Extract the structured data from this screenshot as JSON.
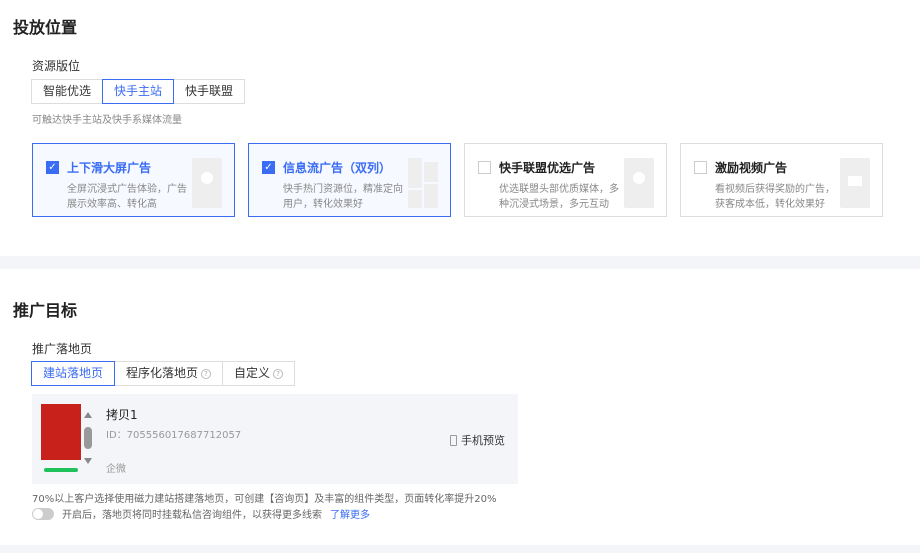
{
  "placement": {
    "title": "投放位置",
    "resource_label": "资源版位",
    "options": [
      "智能优选",
      "快手主站",
      "快手联盟"
    ],
    "selected": "快手主站",
    "hint": "可触达快手主站及快手系媒体流量",
    "cards": [
      {
        "title": "上下滑大屏广告",
        "desc": "全屏沉浸式广告体验，广告展示效率高、转化高",
        "checked": true
      },
      {
        "title": "信息流广告（双列）",
        "desc": "快手热门资源位，精准定向用户，转化效果好",
        "checked": true
      },
      {
        "title": "快手联盟优选广告",
        "desc": "优选联盟头部优质媒体，多种沉浸式场景，多元互动",
        "checked": false
      },
      {
        "title": "激励视频广告",
        "desc": "看视频后获得奖励的广告，获客成本低，转化效果好",
        "checked": false
      }
    ]
  },
  "target": {
    "title": "推广目标",
    "landing_label": "推广落地页",
    "tabs": [
      "建站落地页",
      "程序化落地页",
      "自定义"
    ],
    "selected": "建站落地页",
    "page": {
      "name": "拷贝1",
      "id": "ID：705556017687712057",
      "tag": "企微",
      "preview": "手机预览"
    },
    "note": "70%以上客户选择使用磁力建站搭建落地页，可创建【咨询页】及丰富的组件类型，页面转化率提升20%",
    "toggle_text": "开启后，落地页将同时挂载私信咨询组件，以获得更多线索",
    "toggle_on": false,
    "learn_more": "了解更多"
  },
  "colors": {
    "accent": "#3a6cf4"
  }
}
